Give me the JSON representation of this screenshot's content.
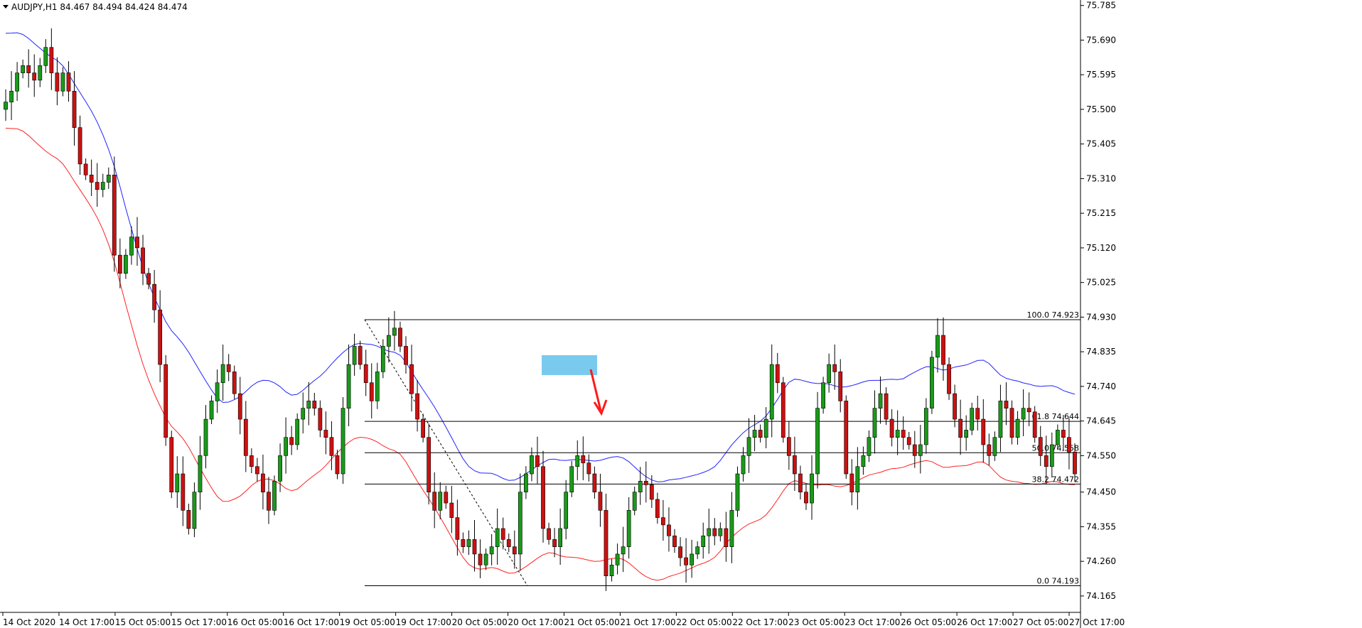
{
  "header": {
    "symbol_line": "AUDJPY,H1  84.467 84.494 84.424 84.474"
  },
  "colors": {
    "background": "#ffffff",
    "bull_candle": "#1a9a1a",
    "bear_candle": "#cc1111",
    "upper_band": "#2222ff",
    "lower_band": "#ff2222",
    "fib_line": "#000000",
    "highlight_box": "#4db8e8",
    "arrow": "#ff1a1a"
  },
  "chart_data": {
    "type": "candlestick",
    "title": "AUDJPY,H1",
    "ylim": [
      74.12,
      75.8
    ],
    "y_ticks": [
      "75.785",
      "75.690",
      "75.595",
      "75.500",
      "75.405",
      "75.310",
      "75.215",
      "75.120",
      "75.025",
      "74.930",
      "74.835",
      "74.740",
      "74.645",
      "74.550",
      "74.450",
      "74.355",
      "74.260",
      "74.165"
    ],
    "x_ticks": [
      "14 Oct 2020",
      "14 Oct 17:00",
      "15 Oct 05:00",
      "15 Oct 17:00",
      "16 Oct 05:00",
      "16 Oct 17:00",
      "19 Oct 05:00",
      "19 Oct 17:00",
      "20 Oct 05:00",
      "20 Oct 17:00",
      "21 Oct 05:00",
      "21 Oct 17:00",
      "22 Oct 05:00",
      "22 Oct 17:00",
      "23 Oct 05:00",
      "23 Oct 17:00",
      "26 Oct 05:00",
      "26 Oct 17:00",
      "27 Oct 05:00",
      "27 Oct 17:00"
    ],
    "close_path": [
      75.52,
      75.55,
      75.6,
      75.62,
      75.6,
      75.58,
      75.62,
      75.67,
      75.6,
      75.55,
      75.6,
      75.55,
      75.45,
      75.35,
      75.32,
      75.3,
      75.28,
      75.3,
      75.32,
      75.1,
      75.05,
      75.1,
      75.15,
      75.12,
      75.05,
      75.02,
      74.95,
      74.8,
      74.6,
      74.45,
      74.5,
      74.4,
      74.35,
      74.45,
      74.55,
      74.65,
      74.7,
      74.75,
      74.8,
      74.78,
      74.72,
      74.65,
      74.55,
      74.52,
      74.5,
      74.45,
      74.4,
      74.48,
      74.55,
      74.6,
      74.58,
      74.65,
      74.68,
      74.7,
      74.68,
      74.62,
      74.6,
      74.55,
      74.5,
      74.68,
      74.8,
      74.85,
      74.8,
      74.75,
      74.7,
      74.78,
      74.85,
      74.88,
      74.9,
      74.85,
      74.8,
      74.72,
      74.65,
      74.6,
      74.45,
      74.4,
      74.45,
      74.42,
      74.38,
      74.32,
      74.3,
      74.32,
      74.28,
      74.25,
      74.28,
      74.3,
      74.35,
      74.32,
      74.3,
      74.28,
      74.45,
      74.5,
      74.55,
      74.52,
      74.35,
      74.32,
      74.3,
      74.35,
      74.45,
      74.52,
      74.55,
      74.53,
      74.5,
      74.45,
      74.4,
      74.22,
      74.25,
      74.28,
      74.3,
      74.4,
      74.45,
      74.48,
      74.47,
      74.43,
      74.38,
      74.36,
      74.33,
      74.3,
      74.27,
      74.25,
      74.28,
      74.3,
      74.33,
      74.35,
      74.33,
      74.35,
      74.3,
      74.4,
      74.5,
      74.55,
      74.6,
      74.62,
      74.6,
      74.65,
      74.8,
      74.75,
      74.6,
      74.55,
      74.5,
      74.45,
      74.42,
      74.5,
      74.68,
      74.75,
      74.8,
      74.78,
      74.7,
      74.5,
      74.45,
      74.52,
      74.55,
      74.6,
      74.68,
      74.72,
      74.65,
      74.6,
      74.62,
      74.6,
      74.58,
      74.55,
      74.58,
      74.68,
      74.82,
      74.88,
      74.8,
      74.72,
      74.65,
      74.6,
      74.62,
      74.68,
      74.65,
      74.58,
      74.55,
      74.6,
      74.7,
      74.68,
      74.6,
      74.65,
      74.68,
      74.67,
      74.6,
      74.55,
      74.52,
      74.58,
      74.62,
      74.6,
      74.56,
      74.5
    ],
    "fib_levels": [
      {
        "label": "100.0 74.923",
        "value": 74.923
      },
      {
        "label": "61.8 74.644",
        "value": 74.644
      },
      {
        "label": "50.0 74.558",
        "value": 74.558
      },
      {
        "label": "38.2 74.472",
        "value": 74.472
      },
      {
        "label": "0.0 74.193",
        "value": 74.193
      }
    ]
  }
}
